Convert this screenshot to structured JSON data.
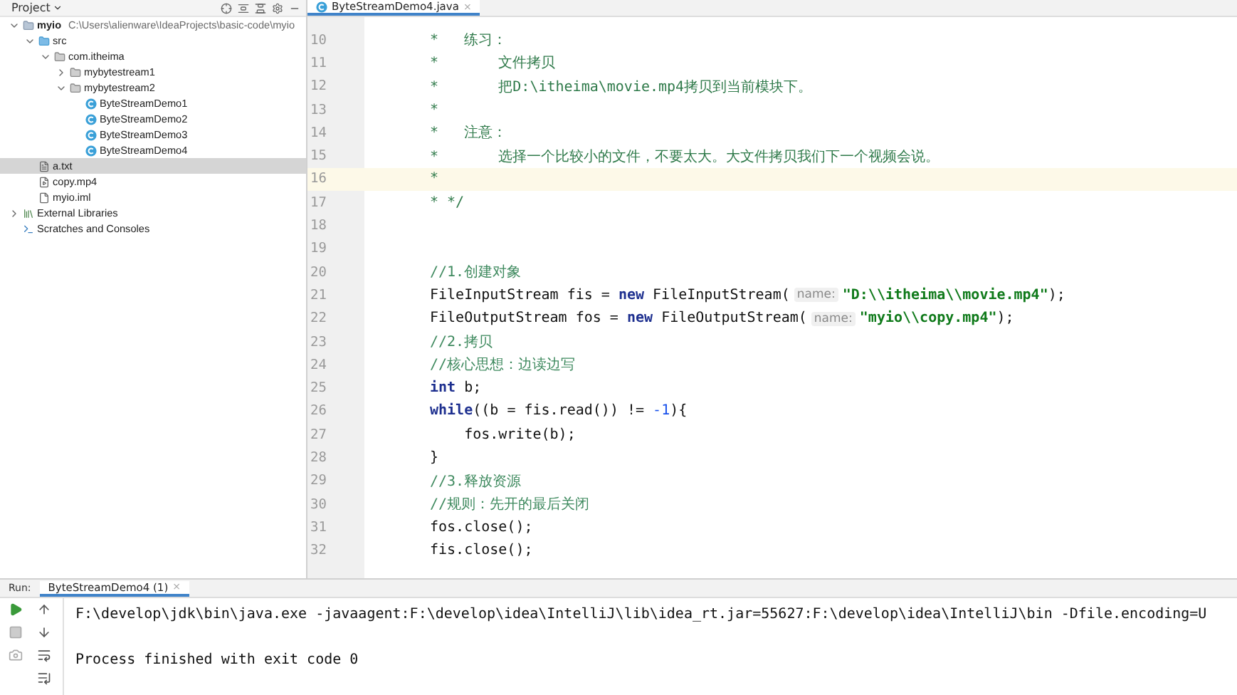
{
  "project_panel": {
    "title": "Project",
    "tree": [
      {
        "label": "myio",
        "kind": "module",
        "path": "C:\\Users\\alienware\\IdeaProjects\\basic-code\\myio",
        "expanded": true,
        "selected": false,
        "children": [
          {
            "label": "src",
            "kind": "source",
            "expanded": true,
            "selected": false,
            "children": [
              {
                "label": "com.itheima",
                "kind": "package",
                "expanded": true,
                "selected": false,
                "children": [
                  {
                    "label": "mybytestream1",
                    "kind": "package",
                    "expanded": false,
                    "selected": false
                  },
                  {
                    "label": "mybytestream2",
                    "kind": "package",
                    "expanded": true,
                    "selected": false,
                    "children": [
                      {
                        "label": "ByteStreamDemo1",
                        "kind": "class",
                        "selected": false
                      },
                      {
                        "label": "ByteStreamDemo2",
                        "kind": "class",
                        "selected": false
                      },
                      {
                        "label": "ByteStreamDemo3",
                        "kind": "class",
                        "selected": false
                      },
                      {
                        "label": "ByteStreamDemo4",
                        "kind": "class",
                        "selected": false
                      }
                    ]
                  }
                ]
              }
            ]
          },
          {
            "label": "a.txt",
            "kind": "text",
            "selected": true
          },
          {
            "label": "copy.mp4",
            "kind": "media",
            "selected": false
          },
          {
            "label": "myio.iml",
            "kind": "iml",
            "selected": false
          }
        ]
      },
      {
        "label": "External Libraries",
        "kind": "library",
        "expanded": false,
        "selected": false
      },
      {
        "label": "Scratches and Consoles",
        "kind": "scratches",
        "selected": false
      }
    ]
  },
  "editor": {
    "tabs": [
      {
        "label": "ByteStreamDemo4.java",
        "close": "×",
        "selected": true
      }
    ],
    "lines": [
      {
        "number": "10",
        "highlighted": false,
        "tokens": [
          {
            "kind": "doc",
            "text": "*   练习："
          }
        ]
      },
      {
        "number": "11",
        "highlighted": false,
        "tokens": [
          {
            "kind": "doc",
            "text": "*       文件拷贝"
          }
        ]
      },
      {
        "number": "12",
        "highlighted": false,
        "tokens": [
          {
            "kind": "doc",
            "text": "*       把D:\\itheima\\movie.mp4拷贝到当前模块下。"
          }
        ]
      },
      {
        "number": "13",
        "highlighted": false,
        "tokens": [
          {
            "kind": "doc",
            "text": "*"
          }
        ]
      },
      {
        "number": "14",
        "highlighted": false,
        "tokens": [
          {
            "kind": "doc",
            "text": "*   注意："
          }
        ]
      },
      {
        "number": "15",
        "highlighted": false,
        "tokens": [
          {
            "kind": "doc",
            "text": "*       选择一个比较小的文件，不要太大。大文件拷贝我们下一个视频会说。"
          }
        ]
      },
      {
        "number": "16",
        "highlighted": true,
        "tokens": [
          {
            "kind": "doc",
            "text": "*"
          }
        ]
      },
      {
        "number": "17",
        "highlighted": false,
        "tokens": [
          {
            "kind": "doc",
            "text": "* */"
          }
        ]
      },
      {
        "number": "18",
        "highlighted": false
      },
      {
        "number": "19",
        "highlighted": false
      },
      {
        "number": "20",
        "highlighted": false,
        "tokens": [
          {
            "kind": "comment",
            "text": "//1.创建对象"
          }
        ]
      },
      {
        "number": "21",
        "highlighted": false,
        "tokens": [
          {
            "kind": "plain",
            "text": "FileInputStream fis = "
          },
          {
            "kind": "keyword",
            "text": "new"
          },
          {
            "kind": "plain",
            "text": " FileInputStream("
          },
          {
            "kind": "hint",
            "text": "name:"
          },
          {
            "kind": "string",
            "text": "\"D:\\\\itheima\\\\movie.mp4\""
          },
          {
            "kind": "plain",
            "text": ");"
          }
        ]
      },
      {
        "number": "22",
        "highlighted": false,
        "tokens": [
          {
            "kind": "plain",
            "text": "FileOutputStream fos = "
          },
          {
            "kind": "keyword",
            "text": "new"
          },
          {
            "kind": "plain",
            "text": " FileOutputStream("
          },
          {
            "kind": "hint",
            "text": "name:"
          },
          {
            "kind": "string",
            "text": "\"myio\\\\copy.mp4\""
          },
          {
            "kind": "plain",
            "text": ");"
          }
        ]
      },
      {
        "number": "23",
        "highlighted": false,
        "tokens": [
          {
            "kind": "comment",
            "text": "//2.拷贝"
          }
        ]
      },
      {
        "number": "24",
        "highlighted": false,
        "tokens": [
          {
            "kind": "comment",
            "text": "//核心思想：边读边写"
          }
        ]
      },
      {
        "number": "25",
        "highlighted": false,
        "tokens": [
          {
            "kind": "keyword",
            "text": "int"
          },
          {
            "kind": "plain",
            "text": " b;"
          }
        ]
      },
      {
        "number": "26",
        "highlighted": false,
        "tokens": [
          {
            "kind": "keyword",
            "text": "while"
          },
          {
            "kind": "plain",
            "text": "((b = fis.read()) != "
          },
          {
            "kind": "number",
            "text": "-1"
          },
          {
            "kind": "plain",
            "text": "){"
          }
        ]
      },
      {
        "number": "27",
        "highlighted": false,
        "tokens": [
          {
            "kind": "plain",
            "text": "    fos.write(b);"
          }
        ]
      },
      {
        "number": "28",
        "highlighted": false,
        "tokens": [
          {
            "kind": "plain",
            "text": "}"
          }
        ]
      },
      {
        "number": "29",
        "highlighted": false,
        "tokens": [
          {
            "kind": "comment",
            "text": "//3.释放资源"
          }
        ]
      },
      {
        "number": "30",
        "highlighted": false,
        "tokens": [
          {
            "kind": "comment",
            "text": "//规则：先开的最后关闭"
          }
        ]
      },
      {
        "number": "31",
        "highlighted": false,
        "tokens": [
          {
            "kind": "plain",
            "text": "fos.close();"
          }
        ]
      },
      {
        "number": "32",
        "highlighted": false,
        "tokens": [
          {
            "kind": "plain",
            "text": "fis.close();"
          }
        ]
      }
    ]
  },
  "run_panel": {
    "label": "Run:",
    "tabs": [
      {
        "label": "ByteStreamDemo4 (1)",
        "close": "×",
        "selected": true
      }
    ],
    "console": [
      {
        "kind": "command",
        "text": "F:\\develop\\jdk\\bin\\java.exe -javaagent:F:\\develop\\idea\\IntelliJ\\lib\\idea_rt.jar=55627:F:\\develop\\idea\\IntelliJ\\bin -Dfile.encoding=U"
      },
      {
        "kind": "status",
        "text": "Process finished with exit code 0"
      }
    ]
  }
}
